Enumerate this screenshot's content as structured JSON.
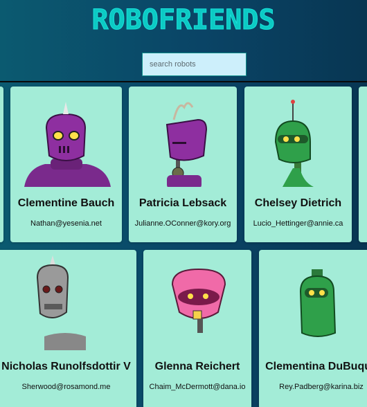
{
  "app": {
    "title": "ROBOFRIENDS"
  },
  "search": {
    "placeholder": "search robots",
    "value": ""
  },
  "robots": [
    {
      "name": "Clementine Bauch",
      "email": "Nathan@yesenia.net"
    },
    {
      "name": "Patricia Lebsack",
      "email": "Julianne.OConner@kory.org"
    },
    {
      "name": "Chelsey Dietrich",
      "email": "Lucio_Hettinger@annie.ca"
    },
    {
      "name": "Nicholas Runolfsdottir V",
      "email": "Sherwood@rosamond.me"
    },
    {
      "name": "Glenna Reichert",
      "email": "Chaim_McDermott@dana.io"
    },
    {
      "name": "Clementina DuBuque",
      "email": "Rey.Padberg@karina.biz"
    }
  ],
  "colors": {
    "background": "#0a4466",
    "card": "#a3ecd7",
    "title": "#0ccac4"
  }
}
